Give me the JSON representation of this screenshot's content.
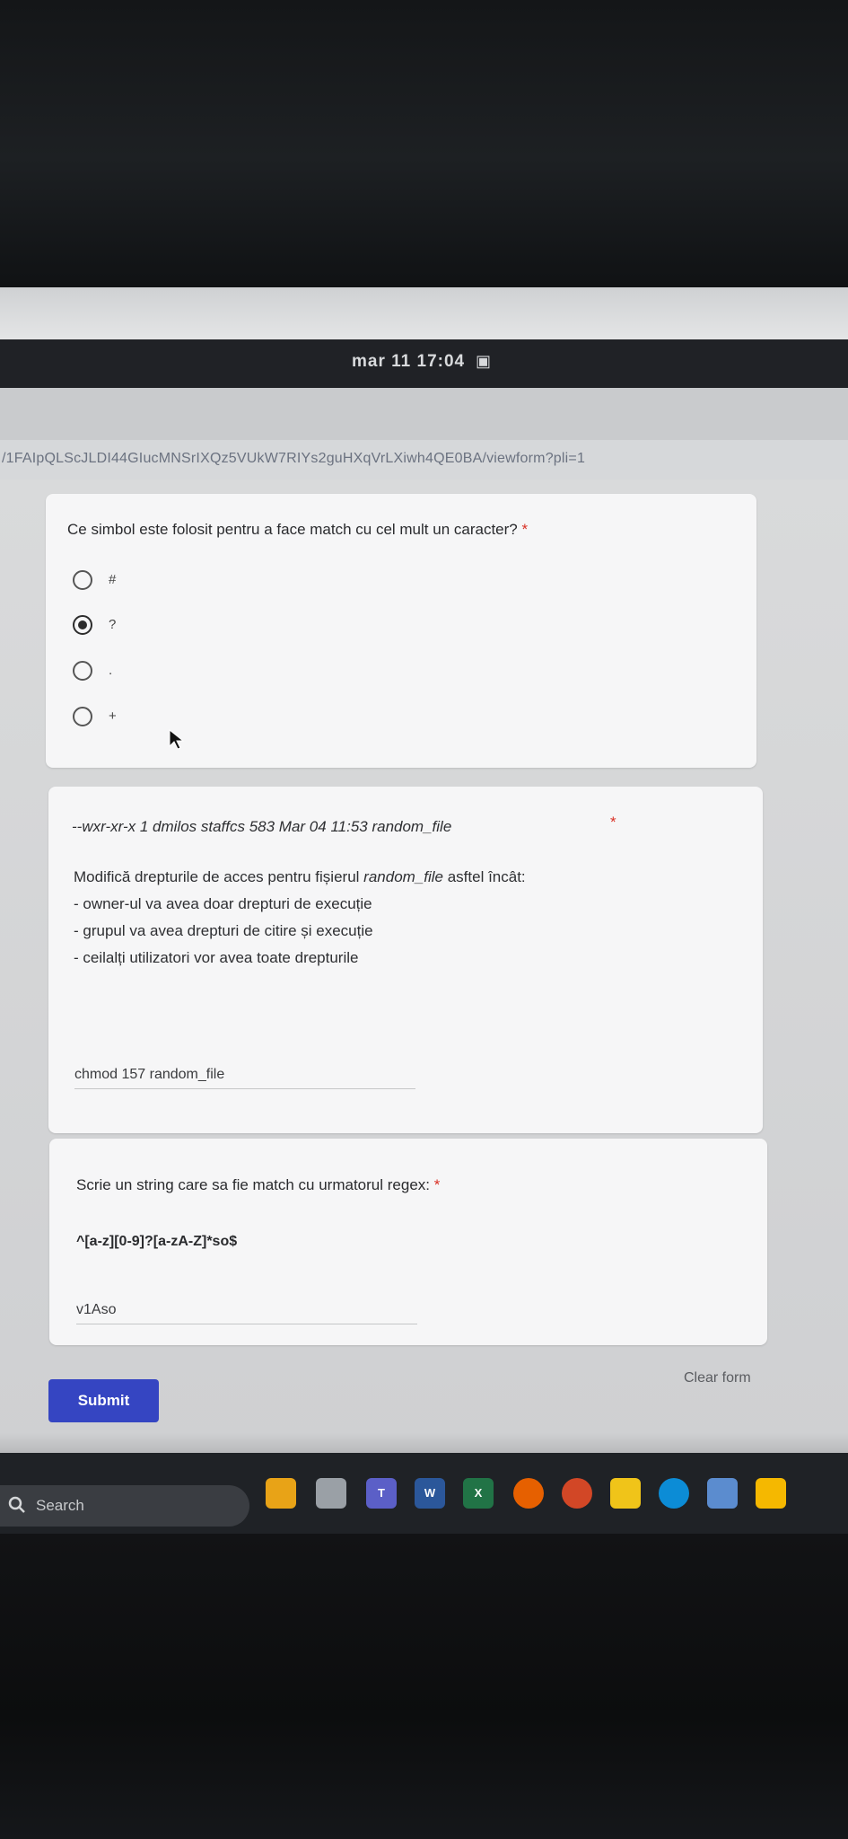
{
  "status_bar": {
    "clock": "mar 11 17:04"
  },
  "browser": {
    "url": "/1FAIpQLScJLDI44GIucMNSrIXQz5VUkW7RIYs2guHXqVrLXiwh4QE0BA/viewform?pli=1"
  },
  "question1": {
    "title": "Ce simbol este folosit pentru a face match cu cel mult un caracter?",
    "required_mark": "*",
    "options": [
      {
        "label": "#",
        "selected": false
      },
      {
        "label": "?",
        "selected": true
      },
      {
        "label": ".",
        "selected": false
      },
      {
        "label": "+",
        "selected": false
      }
    ]
  },
  "question2": {
    "listing": "--wxr-xr-x 1 dmilos staffcs 583 Mar 04 11:53 random_file",
    "required_mark": "*",
    "instruction_prefix": "Modifică drepturile de acces pentru fișierul ",
    "instruction_file": "random_file",
    "instruction_suffix": " asftel încât:",
    "lines": [
      "- owner-ul va avea doar drepturi de execuție",
      "- grupul va avea drepturi de citire și execuție",
      "- ceilalți utilizatori vor avea toate drepturile"
    ],
    "answer": "chmod 157 random_file"
  },
  "question3": {
    "title": "Scrie un string care sa fie match cu urmatorul regex:",
    "required_mark": "*",
    "regex": "^[a-z][0-9]?[a-zA-Z]*so$",
    "answer": "v1Aso"
  },
  "form": {
    "submit_label": "Submit",
    "clear_label": "Clear form"
  },
  "taskbar": {
    "search_label": "Search",
    "apps": [
      {
        "icon": "colorful-app-icon",
        "letter": "",
        "color": "#e8a317"
      },
      {
        "icon": "file-explorer-gray-icon",
        "letter": "",
        "color": "#9aa0a6"
      },
      {
        "icon": "teams-icon",
        "letter": "T",
        "color": "#5b5fc7"
      },
      {
        "icon": "word-icon",
        "letter": "W",
        "color": "#2b579a"
      },
      {
        "icon": "excel-icon",
        "letter": "X",
        "color": "#217346"
      },
      {
        "icon": "firefox-icon",
        "letter": "",
        "color": "#e66000"
      },
      {
        "icon": "powerpoint-icon",
        "letter": "",
        "color": "#d24726"
      },
      {
        "icon": "file-explorer-icon",
        "letter": "",
        "color": "#f0c419"
      },
      {
        "icon": "edge-icon",
        "letter": "",
        "color": "#0c8cd6"
      },
      {
        "icon": "virtualbox-icon",
        "letter": "",
        "color": "#5b8ccf"
      },
      {
        "icon": "sticky-app-icon",
        "letter": "",
        "color": "#f5b800"
      }
    ]
  }
}
